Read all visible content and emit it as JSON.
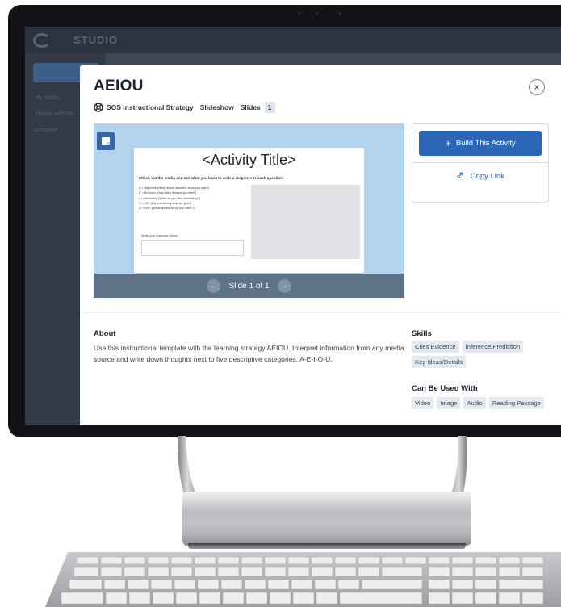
{
  "background_app": {
    "name": "STUDIO",
    "sidebar_items": [
      "My Studio",
      "Shared with Me",
      "Archived"
    ]
  },
  "modal": {
    "title": "AEIOU",
    "strategy_label": "SOS Instructional Strategy",
    "type_label": "Slideshow",
    "slides_label": "Slides",
    "slides_count": "1",
    "close_icon": "×"
  },
  "preview": {
    "slide_title": "<Activity Title>",
    "instruction": "Check out the media and use what you learn to write a response to each question.",
    "lines": [
      "A = Adjective (What words describe what you saw?)",
      "E = Emotion (How does it make you feel?)",
      "I = Interesting (What do you find interesting?)",
      "O = Oh! (Did something surprise you?)",
      "U = Um? (What questions do you have?)"
    ],
    "response_label": "Write your response below.",
    "nav_label": "Slide 1 of 1",
    "prev_icon": "←",
    "next_icon": "→"
  },
  "actions": {
    "build_label": "Build This Activity",
    "plus_icon": "+",
    "copy_label": "Copy Link",
    "link_icon": "🔗"
  },
  "about": {
    "heading": "About",
    "text": "Use this instructional template with the learning strategy AEIOU. Interpret information from any media source and write down thoughts next to five descriptive categories: A-E-I-O-U."
  },
  "skills": {
    "heading": "Skills",
    "tags": [
      "Cites Evidence",
      "Inference/Prediction",
      "Key Ideas/Details"
    ]
  },
  "used_with": {
    "heading": "Can Be Used With",
    "tags": [
      "Video",
      "Image",
      "Audio",
      "Reading Passage"
    ]
  },
  "colors": {
    "primary": "#2c66b6",
    "preview_bg": "#b2d4ee",
    "nav_bar": "#5e7385"
  }
}
